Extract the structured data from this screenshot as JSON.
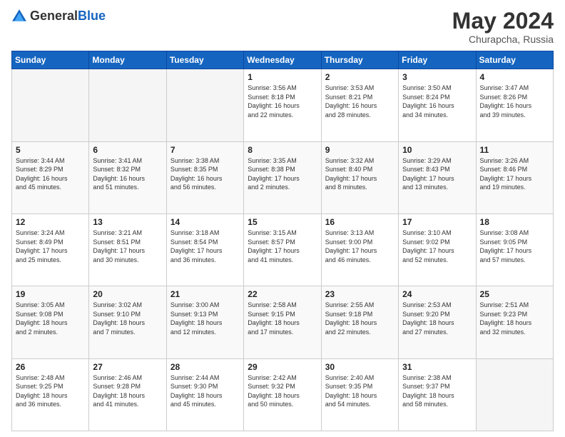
{
  "logo": {
    "general": "General",
    "blue": "Blue"
  },
  "title": "May 2024",
  "location": "Churapcha, Russia",
  "headers": [
    "Sunday",
    "Monday",
    "Tuesday",
    "Wednesday",
    "Thursday",
    "Friday",
    "Saturday"
  ],
  "weeks": [
    [
      {
        "day": "",
        "info": ""
      },
      {
        "day": "",
        "info": ""
      },
      {
        "day": "",
        "info": ""
      },
      {
        "day": "1",
        "info": "Sunrise: 3:56 AM\nSunset: 8:18 PM\nDaylight: 16 hours\nand 22 minutes."
      },
      {
        "day": "2",
        "info": "Sunrise: 3:53 AM\nSunset: 8:21 PM\nDaylight: 16 hours\nand 28 minutes."
      },
      {
        "day": "3",
        "info": "Sunrise: 3:50 AM\nSunset: 8:24 PM\nDaylight: 16 hours\nand 34 minutes."
      },
      {
        "day": "4",
        "info": "Sunrise: 3:47 AM\nSunset: 8:26 PM\nDaylight: 16 hours\nand 39 minutes."
      }
    ],
    [
      {
        "day": "5",
        "info": "Sunrise: 3:44 AM\nSunset: 8:29 PM\nDaylight: 16 hours\nand 45 minutes."
      },
      {
        "day": "6",
        "info": "Sunrise: 3:41 AM\nSunset: 8:32 PM\nDaylight: 16 hours\nand 51 minutes."
      },
      {
        "day": "7",
        "info": "Sunrise: 3:38 AM\nSunset: 8:35 PM\nDaylight: 16 hours\nand 56 minutes."
      },
      {
        "day": "8",
        "info": "Sunrise: 3:35 AM\nSunset: 8:38 PM\nDaylight: 17 hours\nand 2 minutes."
      },
      {
        "day": "9",
        "info": "Sunrise: 3:32 AM\nSunset: 8:40 PM\nDaylight: 17 hours\nand 8 minutes."
      },
      {
        "day": "10",
        "info": "Sunrise: 3:29 AM\nSunset: 8:43 PM\nDaylight: 17 hours\nand 13 minutes."
      },
      {
        "day": "11",
        "info": "Sunrise: 3:26 AM\nSunset: 8:46 PM\nDaylight: 17 hours\nand 19 minutes."
      }
    ],
    [
      {
        "day": "12",
        "info": "Sunrise: 3:24 AM\nSunset: 8:49 PM\nDaylight: 17 hours\nand 25 minutes."
      },
      {
        "day": "13",
        "info": "Sunrise: 3:21 AM\nSunset: 8:51 PM\nDaylight: 17 hours\nand 30 minutes."
      },
      {
        "day": "14",
        "info": "Sunrise: 3:18 AM\nSunset: 8:54 PM\nDaylight: 17 hours\nand 36 minutes."
      },
      {
        "day": "15",
        "info": "Sunrise: 3:15 AM\nSunset: 8:57 PM\nDaylight: 17 hours\nand 41 minutes."
      },
      {
        "day": "16",
        "info": "Sunrise: 3:13 AM\nSunset: 9:00 PM\nDaylight: 17 hours\nand 46 minutes."
      },
      {
        "day": "17",
        "info": "Sunrise: 3:10 AM\nSunset: 9:02 PM\nDaylight: 17 hours\nand 52 minutes."
      },
      {
        "day": "18",
        "info": "Sunrise: 3:08 AM\nSunset: 9:05 PM\nDaylight: 17 hours\nand 57 minutes."
      }
    ],
    [
      {
        "day": "19",
        "info": "Sunrise: 3:05 AM\nSunset: 9:08 PM\nDaylight: 18 hours\nand 2 minutes."
      },
      {
        "day": "20",
        "info": "Sunrise: 3:02 AM\nSunset: 9:10 PM\nDaylight: 18 hours\nand 7 minutes."
      },
      {
        "day": "21",
        "info": "Sunrise: 3:00 AM\nSunset: 9:13 PM\nDaylight: 18 hours\nand 12 minutes."
      },
      {
        "day": "22",
        "info": "Sunrise: 2:58 AM\nSunset: 9:15 PM\nDaylight: 18 hours\nand 17 minutes."
      },
      {
        "day": "23",
        "info": "Sunrise: 2:55 AM\nSunset: 9:18 PM\nDaylight: 18 hours\nand 22 minutes."
      },
      {
        "day": "24",
        "info": "Sunrise: 2:53 AM\nSunset: 9:20 PM\nDaylight: 18 hours\nand 27 minutes."
      },
      {
        "day": "25",
        "info": "Sunrise: 2:51 AM\nSunset: 9:23 PM\nDaylight: 18 hours\nand 32 minutes."
      }
    ],
    [
      {
        "day": "26",
        "info": "Sunrise: 2:48 AM\nSunset: 9:25 PM\nDaylight: 18 hours\nand 36 minutes."
      },
      {
        "day": "27",
        "info": "Sunrise: 2:46 AM\nSunset: 9:28 PM\nDaylight: 18 hours\nand 41 minutes."
      },
      {
        "day": "28",
        "info": "Sunrise: 2:44 AM\nSunset: 9:30 PM\nDaylight: 18 hours\nand 45 minutes."
      },
      {
        "day": "29",
        "info": "Sunrise: 2:42 AM\nSunset: 9:32 PM\nDaylight: 18 hours\nand 50 minutes."
      },
      {
        "day": "30",
        "info": "Sunrise: 2:40 AM\nSunset: 9:35 PM\nDaylight: 18 hours\nand 54 minutes."
      },
      {
        "day": "31",
        "info": "Sunrise: 2:38 AM\nSunset: 9:37 PM\nDaylight: 18 hours\nand 58 minutes."
      },
      {
        "day": "",
        "info": ""
      }
    ]
  ]
}
